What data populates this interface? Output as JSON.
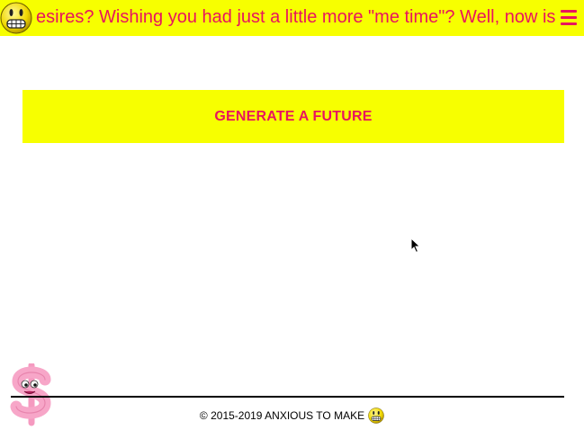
{
  "header": {
    "marquee": "esires? Wishing you had just a little more \"me time\"? Well, now is",
    "logo_icon": "grimace-smiley-icon",
    "menu_icon": "hamburger-menu-icon"
  },
  "main": {
    "generate_label": "GENERATE A FUTURE"
  },
  "footer": {
    "copyright": "© 2015-2019 ANXIOUS TO MAKE",
    "mascot_icon": "dollar-sign-mascot-icon",
    "logo_icon": "grimace-smiley-icon"
  },
  "colors": {
    "accent": "#e8145e",
    "highlight": "#f7ff00"
  }
}
